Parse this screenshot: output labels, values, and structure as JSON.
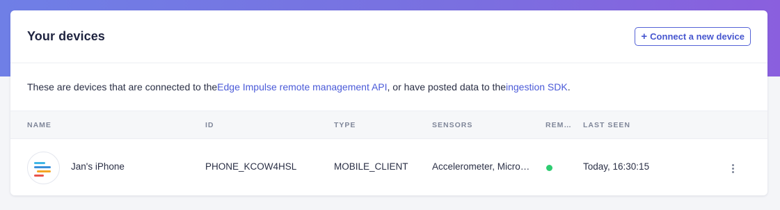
{
  "card": {
    "title": "Your devices",
    "connect_button": "Connect a new device"
  },
  "description": {
    "part1": "These are devices that are connected to the ",
    "link1": "Edge Impulse remote management API",
    "part2": ", or have posted data to the ",
    "link2": "ingestion SDK",
    "part3": "."
  },
  "table": {
    "headers": [
      "NAME",
      "ID",
      "TYPE",
      "SENSORS",
      "REM…",
      "LAST SEEN"
    ],
    "rows": [
      {
        "name": "Jan's iPhone",
        "id": "PHONE_KCOW4HSL",
        "type": "MOBILE_CLIENT",
        "sensors": "Accelerometer, Micro…",
        "remote_status": "online",
        "last_seen": "Today, 16:30:15"
      }
    ]
  },
  "colors": {
    "accent": "#4a5ad8",
    "status_online": "#2ecc71"
  }
}
